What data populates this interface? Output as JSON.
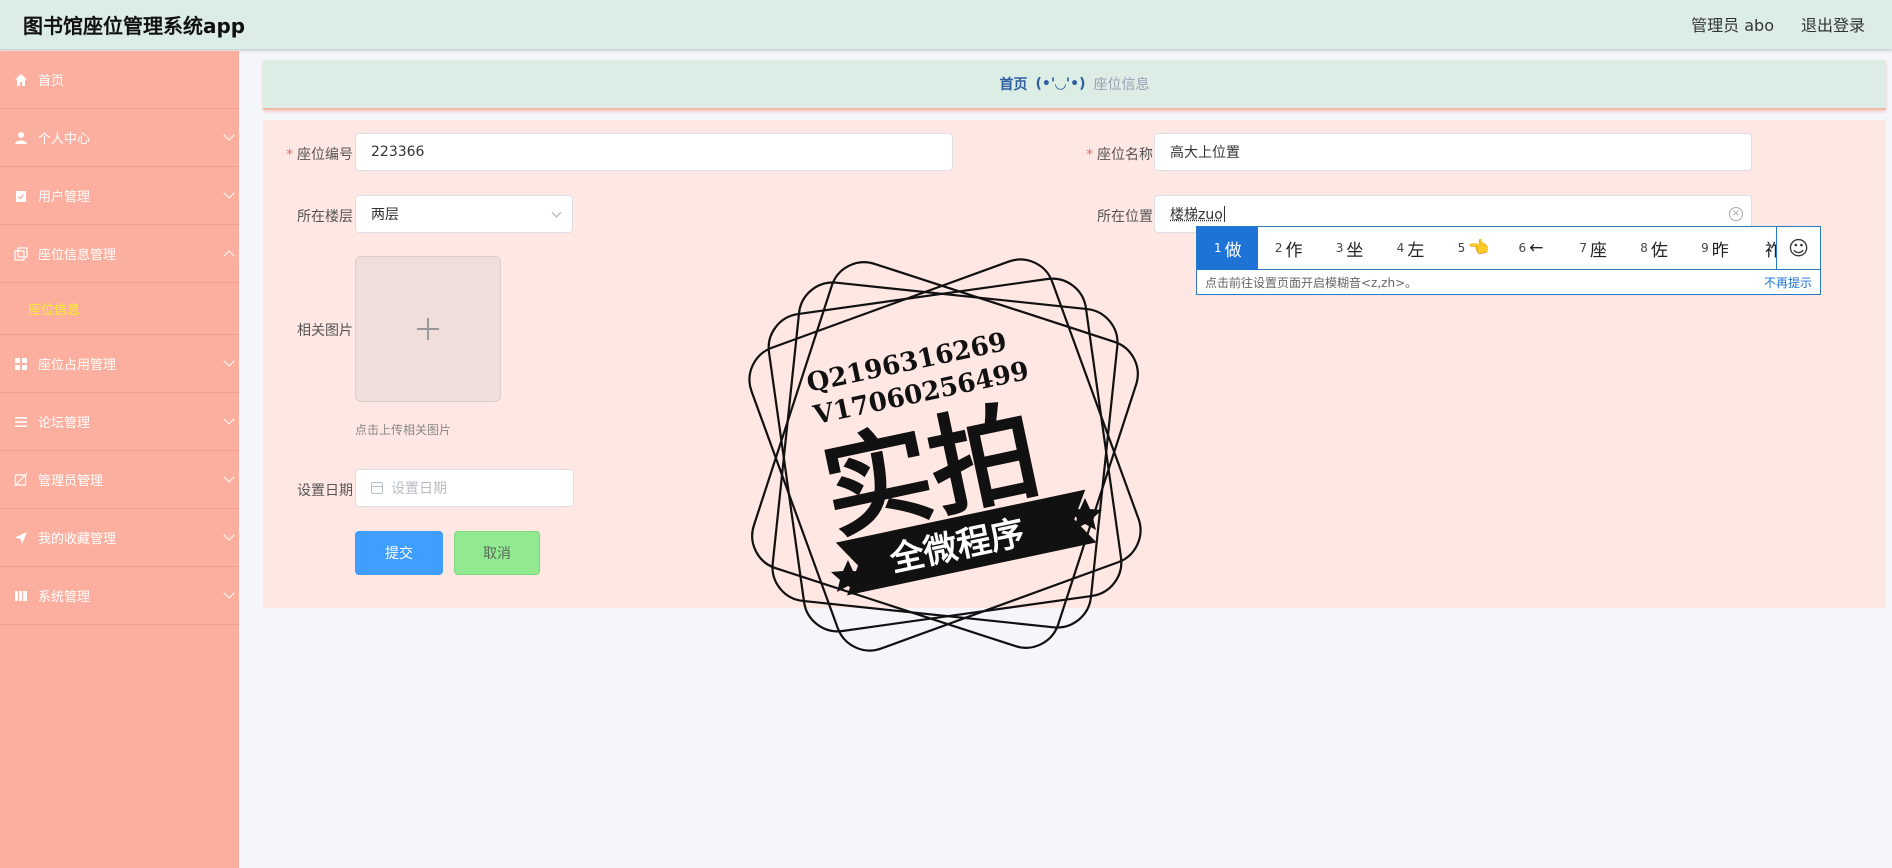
{
  "header": {
    "app_title": "图书馆座位管理系统app",
    "admin_label": "管理员 abo",
    "logout_label": "退出登录"
  },
  "sidebar": {
    "items": [
      {
        "label": "首页",
        "icon": "home-icon"
      },
      {
        "label": "个人中心",
        "icon": "person-icon"
      },
      {
        "label": "用户管理",
        "icon": "clipboard-icon"
      },
      {
        "label": "座位信息管理",
        "icon": "copy-icon",
        "expanded": true,
        "children": [
          {
            "label": "座位信息"
          }
        ]
      },
      {
        "label": "座位占用管理",
        "icon": "grid-icon"
      },
      {
        "label": "论坛管理",
        "icon": "list-icon"
      },
      {
        "label": "管理员管理",
        "icon": "edit-off-icon"
      },
      {
        "label": "我的收藏管理",
        "icon": "send-icon"
      },
      {
        "label": "系统管理",
        "icon": "book-icon"
      }
    ]
  },
  "breadcrumb": {
    "home": "首页",
    "separator": "(•'◡'•)",
    "current": "座位信息"
  },
  "form": {
    "seat_no_label": "座位编号",
    "seat_no_value": "223366",
    "seat_name_label": "座位名称",
    "seat_name_value": "高大上位置",
    "floor_label": "所在楼层",
    "floor_value": "两层",
    "location_label": "所在位置",
    "location_value": "楼梯zuo",
    "image_label": "相关图片",
    "upload_tip": "点击上传相关图片",
    "date_label": "设置日期",
    "date_placeholder": "设置日期",
    "submit_label": "提交",
    "cancel_label": "取消"
  },
  "ime": {
    "candidates": [
      {
        "num": "1",
        "text": "做"
      },
      {
        "num": "2",
        "text": "作"
      },
      {
        "num": "3",
        "text": "坐"
      },
      {
        "num": "4",
        "text": "左"
      },
      {
        "num": "5",
        "text": "👈"
      },
      {
        "num": "6",
        "text": "←"
      },
      {
        "num": "7",
        "text": "座"
      },
      {
        "num": "8",
        "text": "佐"
      },
      {
        "num": "9",
        "text": "昨"
      },
      {
        "num": "",
        "text": "祚"
      }
    ],
    "tip": "点击前往设置页面开启模糊音<z,zh>。",
    "dismiss": "不再提示",
    "emoji_icon": "smiley-icon"
  },
  "stamp": {
    "line1": "Q2196316269",
    "line2": "V17060256499",
    "main": "实拍",
    "banner": "全微程序"
  },
  "colors": {
    "header_bg": "#dcede5",
    "sidebar_bg": "#fdaf9f",
    "panel_bg": "#ffe7e3",
    "submit_bg": "#409eff",
    "cancel_bg": "#91ea8f",
    "active_sub": "#f8ef2d"
  }
}
